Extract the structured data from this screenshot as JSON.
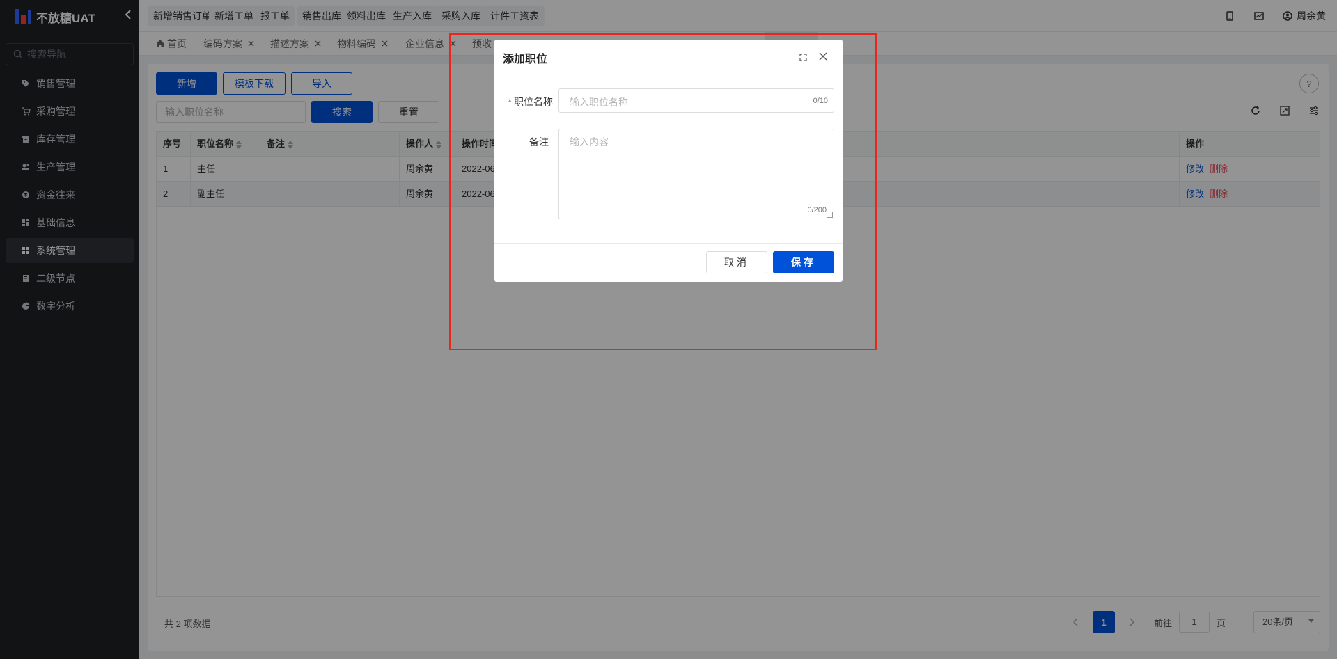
{
  "app": {
    "title": "不放糖UAT"
  },
  "sidebar": {
    "search_placeholder": "搜索导航",
    "items": [
      {
        "label": "销售管理",
        "icon": "tag-icon"
      },
      {
        "label": "采购管理",
        "icon": "cart-icon"
      },
      {
        "label": "库存管理",
        "icon": "box-icon"
      },
      {
        "label": "生产管理",
        "icon": "factory-icon"
      },
      {
        "label": "资金往来",
        "icon": "coin-icon"
      },
      {
        "label": "基础信息",
        "icon": "grid-icon"
      },
      {
        "label": "系统管理",
        "icon": "apps-icon",
        "active": true
      },
      {
        "label": "二级节点",
        "icon": "doc-icon"
      },
      {
        "label": "数字分析",
        "icon": "pie-icon"
      }
    ]
  },
  "topbar": {
    "quick_buttons": [
      "新增销售订单",
      "新增工单",
      "报工单",
      "销售出库",
      "领料出库",
      "生产入库",
      "采购入库",
      "计件工资表"
    ],
    "user_name": "周余黄"
  },
  "tabs": [
    {
      "label": "首页",
      "closable": false
    },
    {
      "label": "编码方案",
      "closable": true
    },
    {
      "label": "描述方案",
      "closable": true
    },
    {
      "label": "物料编码",
      "closable": true
    },
    {
      "label": "企业信息",
      "closable": true
    },
    {
      "label": "预收",
      "closable": false
    }
  ],
  "toolbar": {
    "add_label": "新增",
    "template_label": "模板下载",
    "import_label": "导入",
    "search_placeholder": "输入职位名称",
    "search_label": "搜索",
    "reset_label": "重置"
  },
  "table": {
    "columns": [
      "序号",
      "职位名称",
      "备注",
      "操作人",
      "操作时间",
      "操作"
    ],
    "rows": [
      {
        "index": "1",
        "name": "主任",
        "remark": "",
        "operator": "周余黄",
        "time": "2022-06"
      },
      {
        "index": "2",
        "name": "副主任",
        "remark": "",
        "operator": "周余黄",
        "time": "2022-06"
      }
    ],
    "edit_label": "修改",
    "delete_label": "删除"
  },
  "pagination": {
    "total_text": "共 2 项数据",
    "current_page": "1",
    "goto_prefix": "前往",
    "goto_value": "1",
    "goto_suffix": "页",
    "page_size": "20条/页"
  },
  "dialog": {
    "title": "添加职位",
    "name_label": "职位名称",
    "name_placeholder": "输入职位名称",
    "name_count": "0/10",
    "remark_label": "备注",
    "remark_placeholder": "输入内容",
    "remark_count": "0/200",
    "cancel_label": "取消",
    "save_label": "保存"
  },
  "colors": {
    "primary": "#0052d9",
    "danger": "#e34d59",
    "highlight": "#e8261b"
  }
}
